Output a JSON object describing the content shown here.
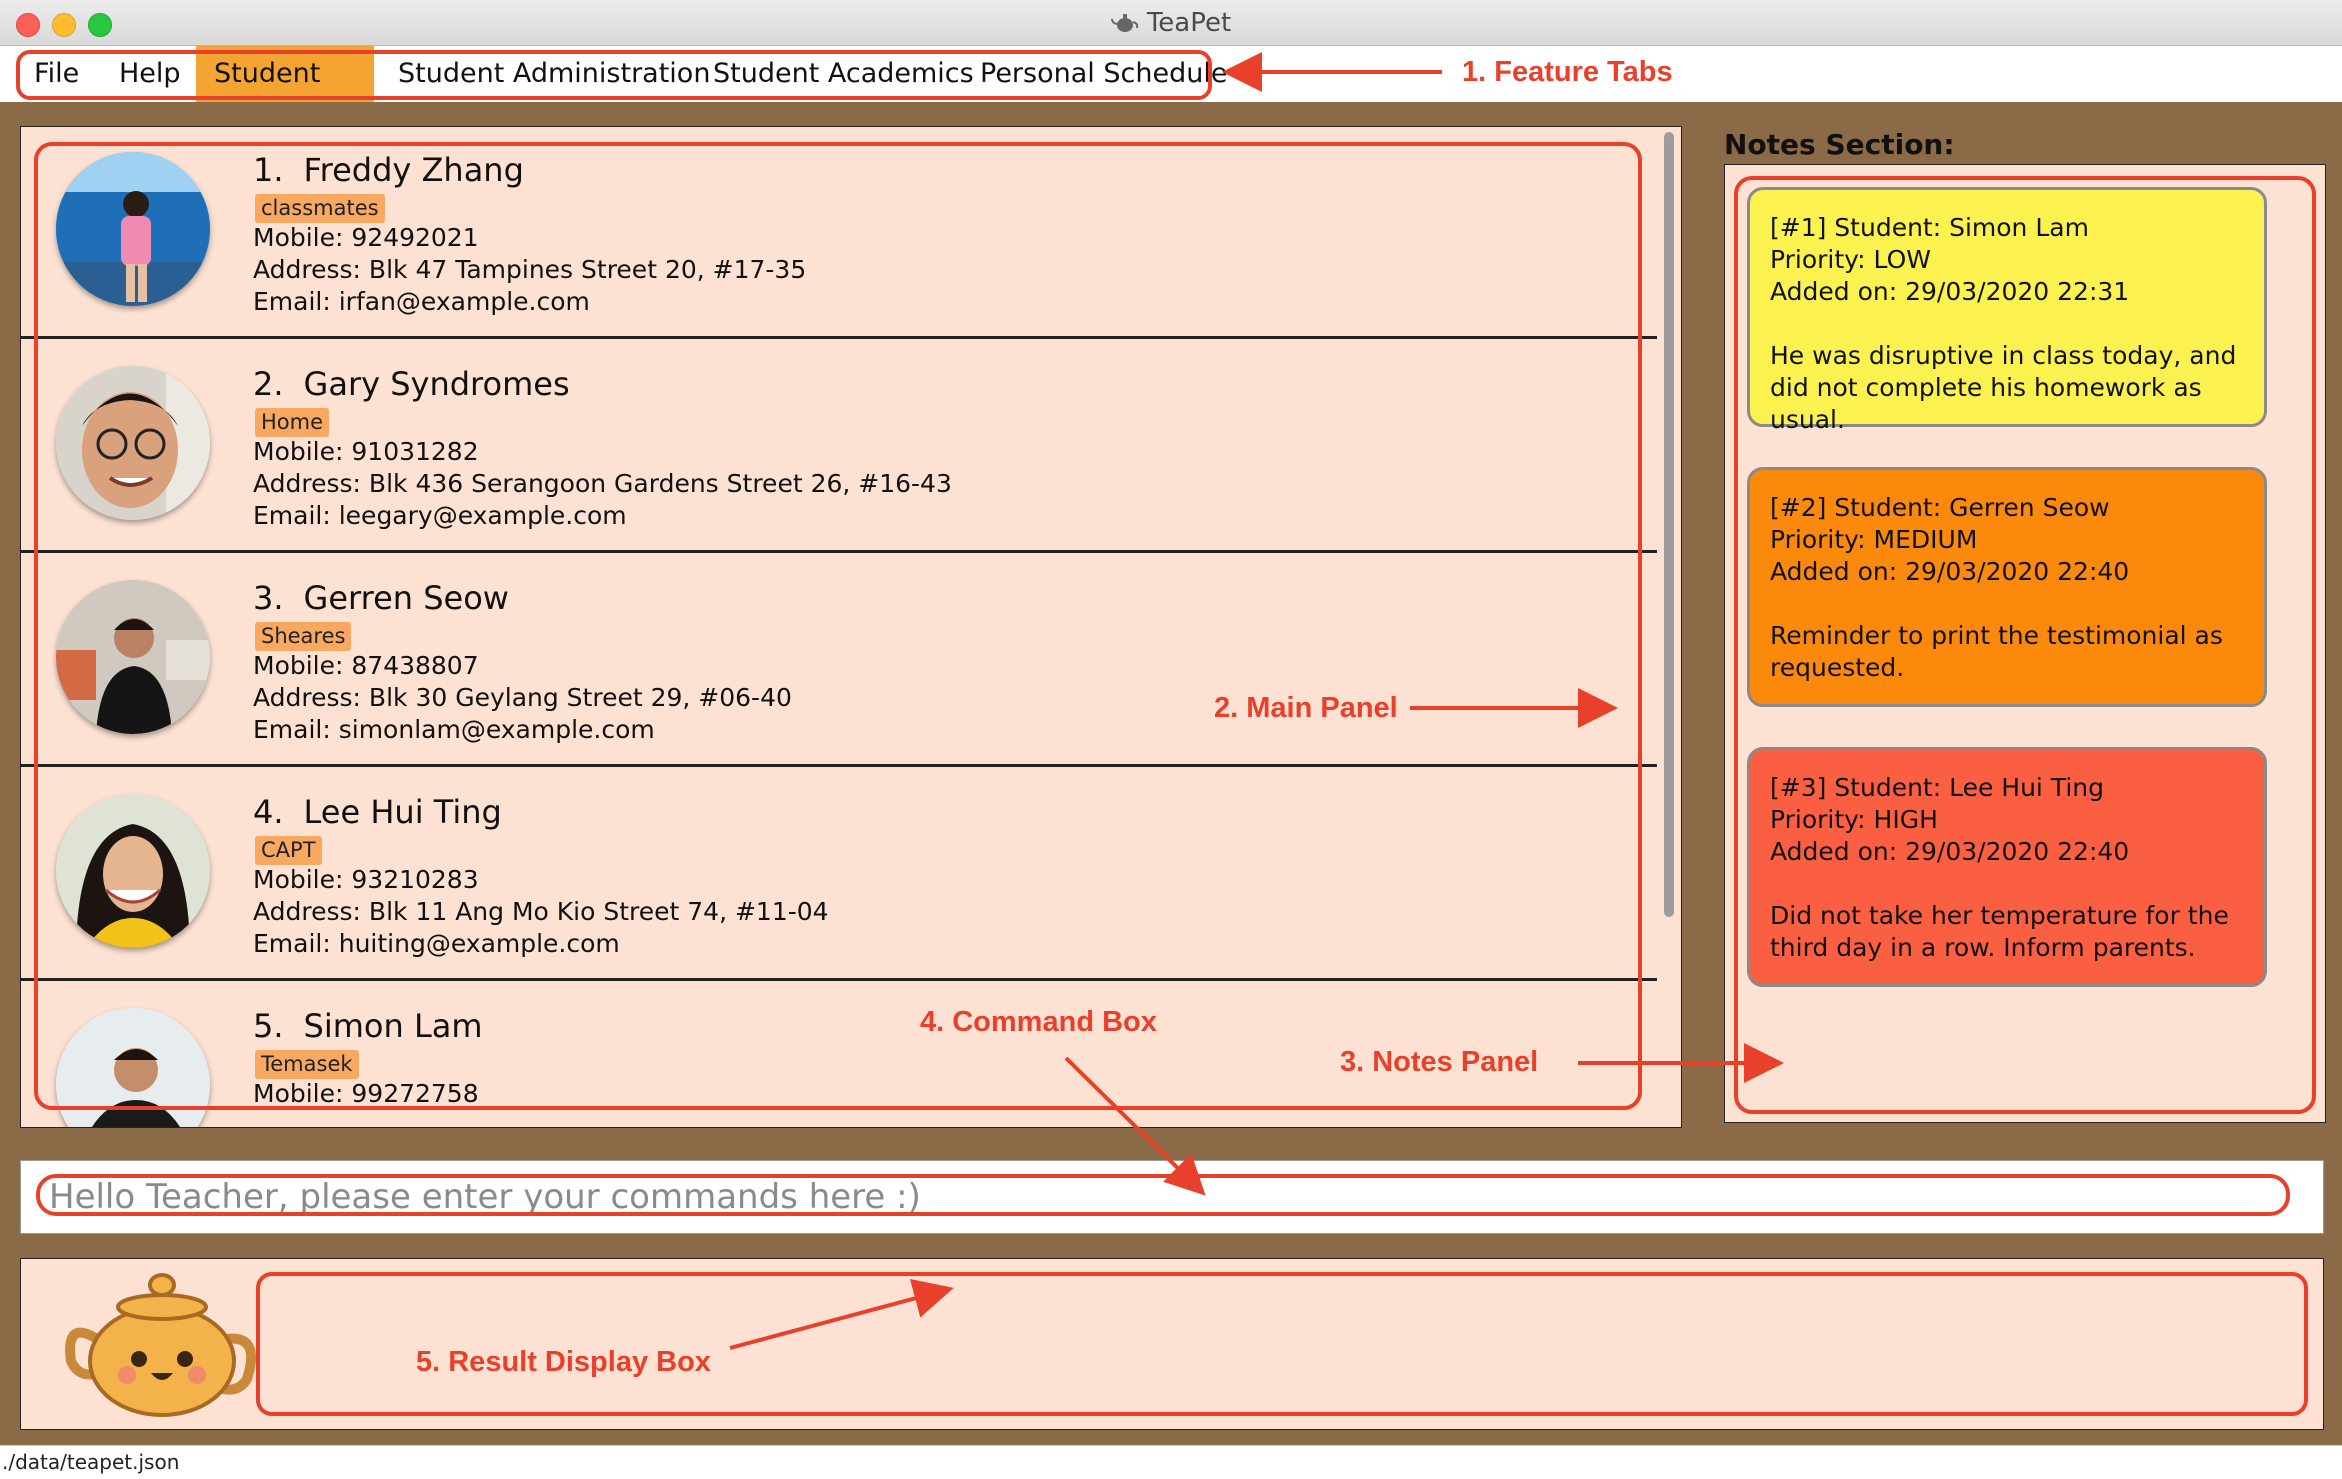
{
  "window": {
    "title": "TeaPet"
  },
  "menu": {
    "items": [
      {
        "label": "File"
      },
      {
        "label": "Help"
      },
      {
        "label": "Student List"
      },
      {
        "label": "Student Administration"
      },
      {
        "label": "Student Academics"
      },
      {
        "label": "Personal Schedule"
      }
    ],
    "active_index": 2
  },
  "students": [
    {
      "index": "1.",
      "name": "Freddy Zhang",
      "tag": "classmates",
      "mobile": "Mobile:  92492021",
      "address": "Address: Blk 47 Tampines Street 20, #17-35",
      "email": "Email:   irfan@example.com"
    },
    {
      "index": "2.",
      "name": "Gary Syndromes",
      "tag": "Home",
      "mobile": "Mobile:  91031282",
      "address": "Address: Blk 436 Serangoon Gardens Street 26, #16-43",
      "email": "Email:   leegary@example.com"
    },
    {
      "index": "3.",
      "name": "Gerren Seow",
      "tag": "Sheares",
      "mobile": "Mobile:  87438807",
      "address": "Address: Blk 30 Geylang Street 29, #06-40",
      "email": "Email:   simonlam@example.com"
    },
    {
      "index": "4.",
      "name": "Lee Hui Ting",
      "tag": "CAPT",
      "mobile": "Mobile:  93210283",
      "address": "Address: Blk 11 Ang Mo Kio Street 74, #11-04",
      "email": "Email:   huiting@example.com"
    },
    {
      "index": "5.",
      "name": "Simon Lam",
      "tag": "Temasek",
      "mobile": "Mobile:  99272758",
      "address": "",
      "email": ""
    }
  ],
  "notes": {
    "header": "Notes Section:",
    "items": [
      {
        "title": "[#1] Student: Simon Lam",
        "priority": "Priority: LOW",
        "added": "Added on: 29/03/2020 22:31",
        "body": "He was disruptive in class today, and did not complete his homework as usual.",
        "color": "#fbf14f"
      },
      {
        "title": "[#2] Student: Gerren Seow",
        "priority": "Priority: MEDIUM",
        "added": "Added on: 29/03/2020 22:40",
        "body": "Reminder to print the testimonial as requested.",
        "color": "#fb8a0c"
      },
      {
        "title": "[#3] Student: Lee Hui Ting",
        "priority": "Priority: HIGH",
        "added": "Added on: 29/03/2020 22:40",
        "body": "Did not take her temperature for the third day in a row. Inform parents.",
        "color": "#fa5f41"
      }
    ]
  },
  "command": {
    "placeholder": "Hello Teacher, please enter your commands here :)",
    "value": ""
  },
  "result": {
    "text": ""
  },
  "status": {
    "path": "./data/teapet.json"
  },
  "annotations": {
    "feature_tabs": "1. Feature Tabs",
    "main_panel": "2. Main Panel",
    "notes_panel": "3. Notes Panel",
    "command_box": "4. Command Box",
    "result_box": "5. Result Display Box",
    "color": "#e8402a"
  }
}
